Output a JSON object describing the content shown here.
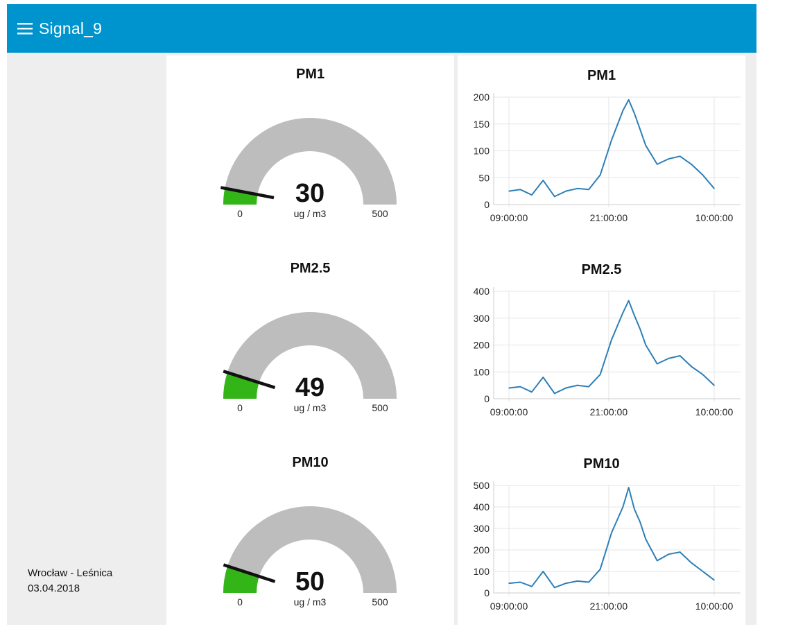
{
  "app": {
    "title": "Signal_9"
  },
  "sidebar": {
    "location": "Wrocław - Leśnica",
    "date": "03.04.2018"
  },
  "gauges": [
    {
      "title": "PM1",
      "value": "30",
      "units": "ug / m3",
      "min": "0",
      "max": "500",
      "level": 30
    },
    {
      "title": "PM2.5",
      "value": "49",
      "units": "ug / m3",
      "min": "0",
      "max": "500",
      "level": 49
    },
    {
      "title": "PM10",
      "value": "50",
      "units": "ug / m3",
      "min": "0",
      "max": "500",
      "level": 50
    }
  ],
  "colors": {
    "accent": "#0094ce",
    "gauge_track": "#bdbdbd",
    "gauge_fill": "#33b518",
    "line": "#2c7fb8",
    "grid": "#e6e6e6"
  },
  "chart_data": [
    {
      "type": "line",
      "title": "PM1",
      "x_tick_labels": [
        "09:00:00",
        "21:00:00",
        "10:00:00"
      ],
      "y_ticks": [
        0,
        50,
        100,
        150,
        200
      ],
      "ylim": [
        0,
        200
      ],
      "x": [
        0,
        2,
        4,
        6,
        8,
        10,
        12,
        14,
        16,
        18,
        20,
        21,
        22,
        23,
        24,
        26,
        28,
        30,
        32,
        34,
        36
      ],
      "values": [
        25,
        28,
        18,
        45,
        15,
        25,
        30,
        28,
        55,
        120,
        175,
        195,
        170,
        140,
        110,
        75,
        85,
        90,
        75,
        55,
        30
      ],
      "grid": true
    },
    {
      "type": "line",
      "title": "PM2.5",
      "x_tick_labels": [
        "09:00:00",
        "21:00:00",
        "10:00:00"
      ],
      "y_ticks": [
        0,
        100,
        200,
        300,
        400
      ],
      "ylim": [
        0,
        400
      ],
      "x": [
        0,
        2,
        4,
        6,
        8,
        10,
        12,
        14,
        16,
        18,
        20,
        21,
        22,
        23,
        24,
        26,
        28,
        30,
        32,
        34,
        36
      ],
      "values": [
        40,
        45,
        25,
        80,
        20,
        40,
        50,
        45,
        90,
        220,
        320,
        365,
        310,
        260,
        200,
        130,
        150,
        160,
        120,
        90,
        50
      ],
      "grid": true
    },
    {
      "type": "line",
      "title": "PM10",
      "x_tick_labels": [
        "09:00:00",
        "21:00:00",
        "10:00:00"
      ],
      "y_ticks": [
        0,
        100,
        200,
        300,
        400,
        500
      ],
      "ylim": [
        0,
        500
      ],
      "x": [
        0,
        2,
        4,
        6,
        8,
        10,
        12,
        14,
        16,
        18,
        20,
        21,
        22,
        23,
        24,
        26,
        28,
        30,
        32,
        34,
        36
      ],
      "values": [
        45,
        50,
        30,
        100,
        25,
        45,
        55,
        50,
        110,
        280,
        400,
        490,
        390,
        330,
        250,
        150,
        180,
        190,
        140,
        100,
        60
      ],
      "grid": true
    }
  ]
}
